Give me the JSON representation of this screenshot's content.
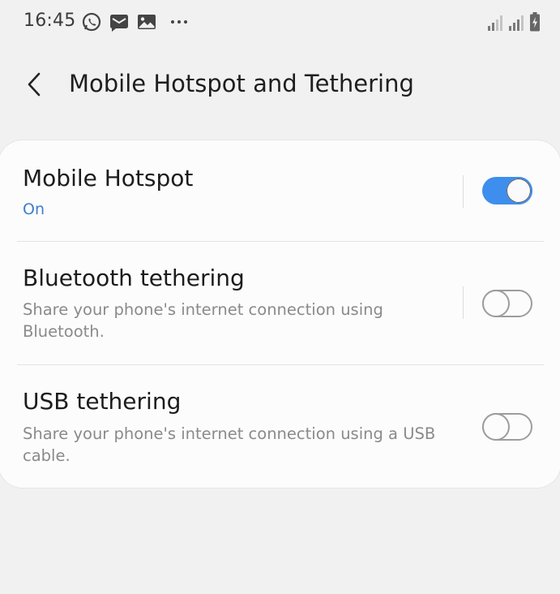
{
  "status_bar": {
    "time": "16:45",
    "left_icons": [
      "whatsapp-icon",
      "message-icon",
      "gallery-icon",
      "more-dots-icon"
    ],
    "right_icons": [
      "signal-1-icon",
      "signal-2-icon",
      "battery-charging-icon"
    ]
  },
  "header": {
    "back_icon": "chevron-left-icon",
    "title": "Mobile Hotspot and Tethering"
  },
  "settings": [
    {
      "title": "Mobile Hotspot",
      "subtitle": "On",
      "enabled": true
    },
    {
      "title": "Bluetooth tethering",
      "subtitle": "Share your phone's internet connection using Bluetooth.",
      "enabled": false
    },
    {
      "title": "USB tethering",
      "subtitle": "Share your phone's internet connection using a USB cable.",
      "enabled": false
    }
  ],
  "colors": {
    "accent": "#3e8eed",
    "status_on_text": "#3c7fcf",
    "background": "#f1f1f1",
    "card": "#fcfcfc"
  }
}
